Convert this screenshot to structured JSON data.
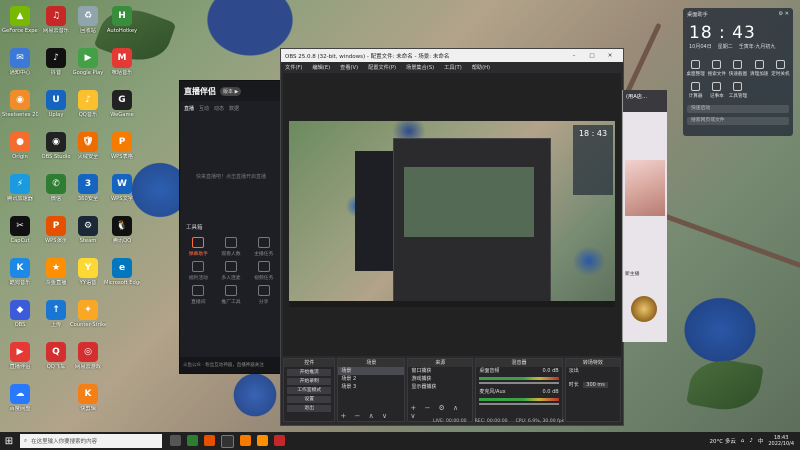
{
  "desktop": {
    "col1": [
      {
        "label": "GeForce\nExperience",
        "icon": "nvidia-icon",
        "color": "#76b900",
        "glyph": "▲"
      },
      {
        "label": "通知中心",
        "icon": "notify-icon",
        "color": "#3c78d8",
        "glyph": "✉"
      },
      {
        "label": "Steelseries\n2020",
        "icon": "steelseries-icon",
        "color": "#f08c2a",
        "glyph": "◉"
      },
      {
        "label": "Origin",
        "icon": "origin-icon",
        "color": "#f56c2d",
        "glyph": "●"
      },
      {
        "label": "腾讯加速器",
        "icon": "accelerator-icon",
        "color": "#1a9be0",
        "glyph": "⚡"
      },
      {
        "label": "CapCut",
        "icon": "capcut-icon",
        "color": "#111",
        "glyph": "✂"
      },
      {
        "label": "酷狗音乐",
        "icon": "kugou-icon",
        "color": "#1e88e5",
        "glyph": "K"
      },
      {
        "label": "OBS",
        "icon": "obs-small-icon",
        "color": "#3b5bdb",
        "glyph": "◆"
      },
      {
        "label": "直播伴侣",
        "icon": "live-icon",
        "color": "#e53935",
        "glyph": "▶"
      },
      {
        "label": "百度网盘",
        "icon": "baidu-pan-icon",
        "color": "#2979ff",
        "glyph": "☁"
      }
    ],
    "col2": [
      {
        "label": "网易云音乐",
        "icon": "netease-icon",
        "color": "#c62828",
        "glyph": "♫"
      },
      {
        "label": "抖音",
        "icon": "douyin-icon",
        "color": "#111",
        "glyph": "♪"
      },
      {
        "label": "Uplay",
        "icon": "uplay-icon",
        "color": "#1565c0",
        "glyph": "U"
      },
      {
        "label": "OBS Studio",
        "icon": "obs-icon",
        "color": "#222",
        "glyph": "◉"
      },
      {
        "label": "微信",
        "icon": "wechat-icon",
        "color": "#2e7d32",
        "glyph": "✆"
      },
      {
        "label": "WPS演示",
        "icon": "wps-ppt-icon",
        "color": "#e65100",
        "glyph": "P"
      },
      {
        "label": "斗鱼直播",
        "icon": "douyu-icon",
        "color": "#ff8f00",
        "glyph": "★"
      },
      {
        "label": "上传",
        "icon": "upload-icon",
        "color": "#1976d2",
        "glyph": "↑"
      },
      {
        "label": "QQ飞车",
        "icon": "qq-speed-icon",
        "color": "#d32f2f",
        "glyph": "Q"
      }
    ],
    "col3": [
      {
        "label": "回收站",
        "icon": "recycle-bin-icon",
        "color": "#90a4ae",
        "glyph": "♻"
      },
      {
        "label": "Google\nPlay",
        "icon": "google-play-icon",
        "color": "#43a047",
        "glyph": "▶"
      },
      {
        "label": "QQ音乐",
        "icon": "qq-music-icon",
        "color": "#fbc02d",
        "glyph": "♪"
      },
      {
        "label": "火绒安全",
        "icon": "security-icon",
        "color": "#ef6c00",
        "glyph": "🛡"
      },
      {
        "label": "360安全",
        "icon": "360-icon",
        "color": "#1565c0",
        "glyph": "3"
      },
      {
        "label": "Steam",
        "icon": "steam-icon",
        "color": "#1b2838",
        "glyph": "⚙"
      },
      {
        "label": "YY语音",
        "icon": "yy-icon",
        "color": "#fdd835",
        "glyph": "Y"
      },
      {
        "label": "Counter-Strike\nGlobal",
        "icon": "csgo-icon",
        "color": "#f9a825",
        "glyph": "✦"
      },
      {
        "label": "网易云游戏",
        "icon": "netease-game-icon",
        "color": "#d32f2f",
        "glyph": "◎"
      },
      {
        "label": "快剪辑",
        "icon": "clip-icon",
        "color": "#f57f17",
        "glyph": "K"
      }
    ],
    "col4": [
      {
        "label": "AutoHotkey",
        "icon": "autohotkey-icon",
        "color": "#388e3c",
        "glyph": "H"
      },
      {
        "label": "咪咕音乐",
        "icon": "migu-icon",
        "color": "#e53935",
        "glyph": "M"
      },
      {
        "label": "WeGame",
        "icon": "wegame-icon",
        "color": "#222",
        "glyph": "G"
      },
      {
        "label": "WPS表格",
        "icon": "wps-sheet-icon",
        "color": "#f57c00",
        "glyph": "P"
      },
      {
        "label": "WPS文字",
        "icon": "wps-word-icon",
        "color": "#1565c0",
        "glyph": "W"
      },
      {
        "label": "腾讯QQ",
        "icon": "qq-icon",
        "color": "#111",
        "glyph": "🐧"
      },
      {
        "label": "Microsoft\nEdge",
        "icon": "edge-icon",
        "color": "#0277bd",
        "glyph": "e"
      }
    ]
  },
  "companion": {
    "logo": "直播伴侣",
    "tag": "版本 ▶",
    "tabs": [
      "直播",
      "互动",
      "动态",
      "数据"
    ],
    "empty_hint": "快来直播吧！点击直播开启直播",
    "tools_title": "工具箱",
    "tools": [
      "弹幕助手",
      "观看人数",
      "主播任务",
      "福利活动",
      "多人连麦",
      "视频任务",
      "直播间",
      "推广工具",
      "分享"
    ],
    "bottom_text": "斗鱼公众 · 粉丝互动神器，直播神器关注"
  },
  "obs": {
    "title": "OBS 25.0.8 (32-bit, windows) - 配置文件: 未命名 - 场景: 未命名",
    "menu": [
      "文件(F)",
      "编辑(E)",
      "查看(V)",
      "配置文件(P)",
      "场景集合(S)",
      "工具(T)",
      "帮助(H)"
    ],
    "docks": {
      "controls_title": "控件",
      "controls": [
        "开始推流",
        "开始录制",
        "工作室模式",
        "设置",
        "退出"
      ],
      "scenes_title": "场景",
      "scenes": [
        "场景",
        "场景 2",
        "场景 3"
      ],
      "sources_title": "来源",
      "sources": [
        "窗口捕获",
        "游戏捕获",
        "显示器捕获"
      ],
      "mixer_title": "混音器",
      "mixer": [
        "桌面音频",
        "麦克风/Aux"
      ],
      "mixer_db": [
        "0.0 dB",
        "0.0 dB"
      ],
      "trans_title": "转场特效",
      "trans": [
        "淡出",
        "时长"
      ],
      "trans_ms": "300 ms"
    },
    "status": [
      "LIVE: 00:00:00",
      "REC: 00:00:00",
      "CPU: 6.9%, 30.00 fps"
    ]
  },
  "clock": {
    "label": "桌面助手",
    "time": "18 : 43",
    "date": [
      "10月04日",
      "星期二",
      "壬寅年·九月初九"
    ],
    "items": [
      "桌面整理",
      "搜索文件",
      "快速截图",
      "清理加速",
      "定时关机",
      "计算器",
      "记事本",
      "工具管理"
    ],
    "search_placeholder": "快速启动",
    "file_search": "搜索网页或文件"
  },
  "chat": {
    "title": "(用A店…",
    "subtitle": "新主播"
  },
  "taskbar": {
    "search_placeholder": "在这里输入你要搜索的内容",
    "weather": "20°C 多云",
    "time": "18:43",
    "date": "2022/10/4",
    "lang": "中"
  }
}
